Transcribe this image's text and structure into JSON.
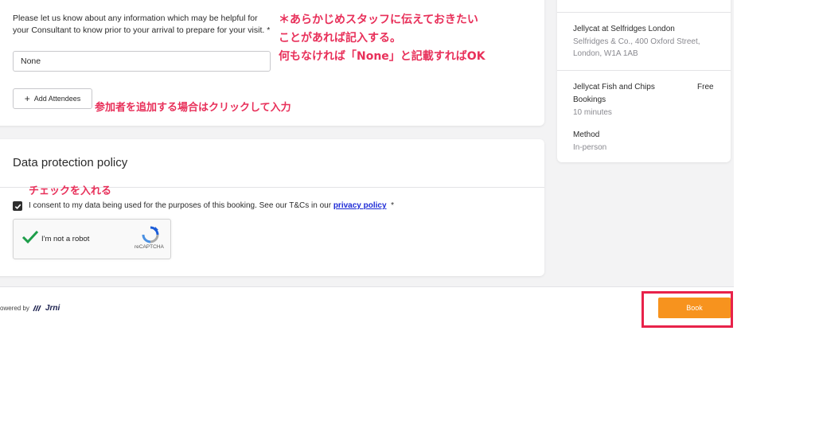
{
  "form": {
    "help_text": "Please let us know about any information which may be helpful for your Consultant to know prior to your arrival to prepare for your visit. *",
    "notes_value": "None",
    "add_attendees_label": "Add Attendees"
  },
  "annotations": {
    "note_line1": "＊あらかじめスタッフに伝えておきたい",
    "note_line2": "ことがあれば記入する。",
    "note_line3": "何もなければ「None」と記載すればOK",
    "add_attendee_note": "参加者を追加する場合はクリックして入力",
    "checkbox_note": "チェックを入れる",
    "color": "#e8305a"
  },
  "data_protection": {
    "title": "Data protection policy",
    "consent_text": "I consent to my data being used for the purposes of this booking. See our T&Cs in our ",
    "privacy_link": "privacy policy",
    "required_mark": "*",
    "checked": true
  },
  "captcha": {
    "label": "I'm not a robot",
    "brand": "reCAPTCHA"
  },
  "sidebar": {
    "location_name": "Jellycat at Selfridges London",
    "address_line1": "Selfridges & Co., 400 Oxford Street,",
    "address_line2": "London, W1A 1AB",
    "service_name_line1": "Jellycat Fish and Chips",
    "service_name_line2": "Bookings",
    "service_price": "Free",
    "duration": "10 minutes",
    "method_label": "Method",
    "method_value": "In-person"
  },
  "footer": {
    "powered_by": "owered by",
    "logo_text": "Jrni",
    "book_label": "Book",
    "book_color": "#f7931e",
    "highlight_color": "#e8224a"
  }
}
